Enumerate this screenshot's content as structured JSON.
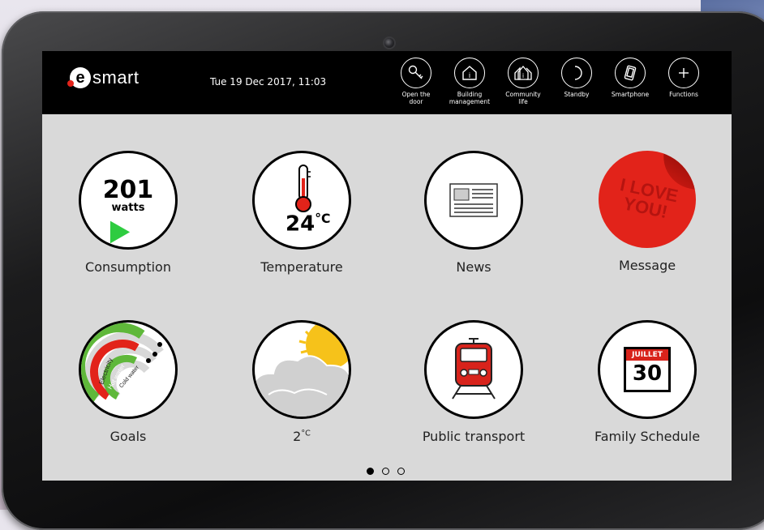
{
  "header": {
    "logo_mark": "e",
    "logo_text": "smart",
    "datetime": "Tue 19 Dec 2017, 11:03"
  },
  "toolbar": [
    {
      "label": "Open the\ndoor",
      "icon": "key-icon"
    },
    {
      "label": "Building\nmanagement",
      "icon": "building-icon"
    },
    {
      "label": "Community\nlife",
      "icon": "community-icon"
    },
    {
      "label": "Standby",
      "icon": "moon-icon"
    },
    {
      "label": "Smartphone",
      "icon": "smartphone-icon"
    },
    {
      "label": "Functions",
      "icon": "plus-icon"
    }
  ],
  "tiles": {
    "consumption": {
      "label": "Consumption",
      "value": "201",
      "unit": "watts"
    },
    "temperature": {
      "label": "Temperature",
      "value": "24",
      "unit": "°C"
    },
    "news": {
      "label": "News"
    },
    "message": {
      "label": "Message",
      "sticker_text_1": "I LOVE",
      "sticker_text_2": "YOU!"
    },
    "goals": {
      "label": "Goals",
      "ring_labels": [
        "Electricity",
        "Hot water",
        "Cold water"
      ]
    },
    "weather": {
      "label": "2",
      "unit": "°C"
    },
    "transport": {
      "label": "Public transport"
    },
    "schedule": {
      "label": "Family Schedule",
      "month": "JUILLET",
      "day": "30"
    }
  },
  "pagination": {
    "pages": 3,
    "current": 1
  },
  "colors": {
    "accent_red": "#e2231a",
    "green": "#2ecc40",
    "sun": "#f6c21a",
    "screen_bg": "#d9d9d9"
  }
}
